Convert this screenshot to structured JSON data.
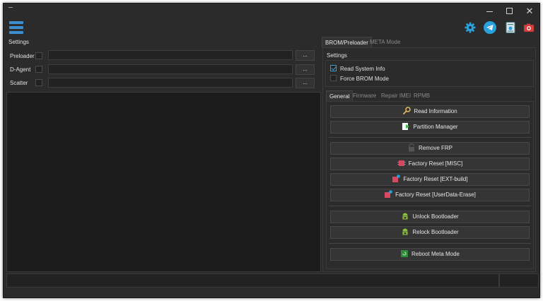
{
  "window": {
    "controls": {
      "minimize": "minimize",
      "maximize": "maximize",
      "close": "✕"
    }
  },
  "toolbar": {
    "menu_icon": "hamburger-menu-icon",
    "icons": [
      "gear-icon",
      "telegram-icon",
      "report-icon",
      "camera-icon"
    ],
    "accent": "#3b8fd0"
  },
  "left": {
    "settings_title": "Settings",
    "rows": [
      {
        "label": "Preloader",
        "value": "",
        "browse": "..."
      },
      {
        "label": "D-Agent",
        "value": "",
        "browse": "..."
      },
      {
        "label": "Scatter",
        "value": "",
        "browse": "..."
      }
    ]
  },
  "main_tabs": [
    {
      "label": "BROM/Preloader",
      "active": true
    },
    {
      "label": "META Mode",
      "active": false
    }
  ],
  "right": {
    "settings_title": "Settings",
    "options": [
      {
        "label": "Read System Info",
        "checked": true
      },
      {
        "label": "Force BROM Mode",
        "checked": false
      }
    ],
    "sub_tabs": [
      {
        "label": "General",
        "active": true
      },
      {
        "label": "Firmware",
        "active": false
      },
      {
        "label": "Repair IMEI",
        "active": false
      },
      {
        "label": "RPMB",
        "active": false
      }
    ],
    "actions": [
      {
        "label": "Read Information",
        "icon": "magnifier-icon"
      },
      {
        "label": "Partition Manager",
        "icon": "partition-icon"
      },
      {
        "label": "Remove FRP",
        "icon": "lock-icon"
      },
      {
        "label": "Factory Reset [MISC]",
        "icon": "chip-icon"
      },
      {
        "label": "Factory Reset [EXT-build]",
        "icon": "chip-icon"
      },
      {
        "label": "Factory Reset [UserData-Erase]",
        "icon": "chip-icon"
      },
      {
        "label": "Unlock Bootloader",
        "icon": "android-icon"
      },
      {
        "label": "Relock Bootloader",
        "icon": "android-icon"
      },
      {
        "label": "Reboot Meta Mode",
        "icon": "reboot-icon"
      }
    ]
  }
}
